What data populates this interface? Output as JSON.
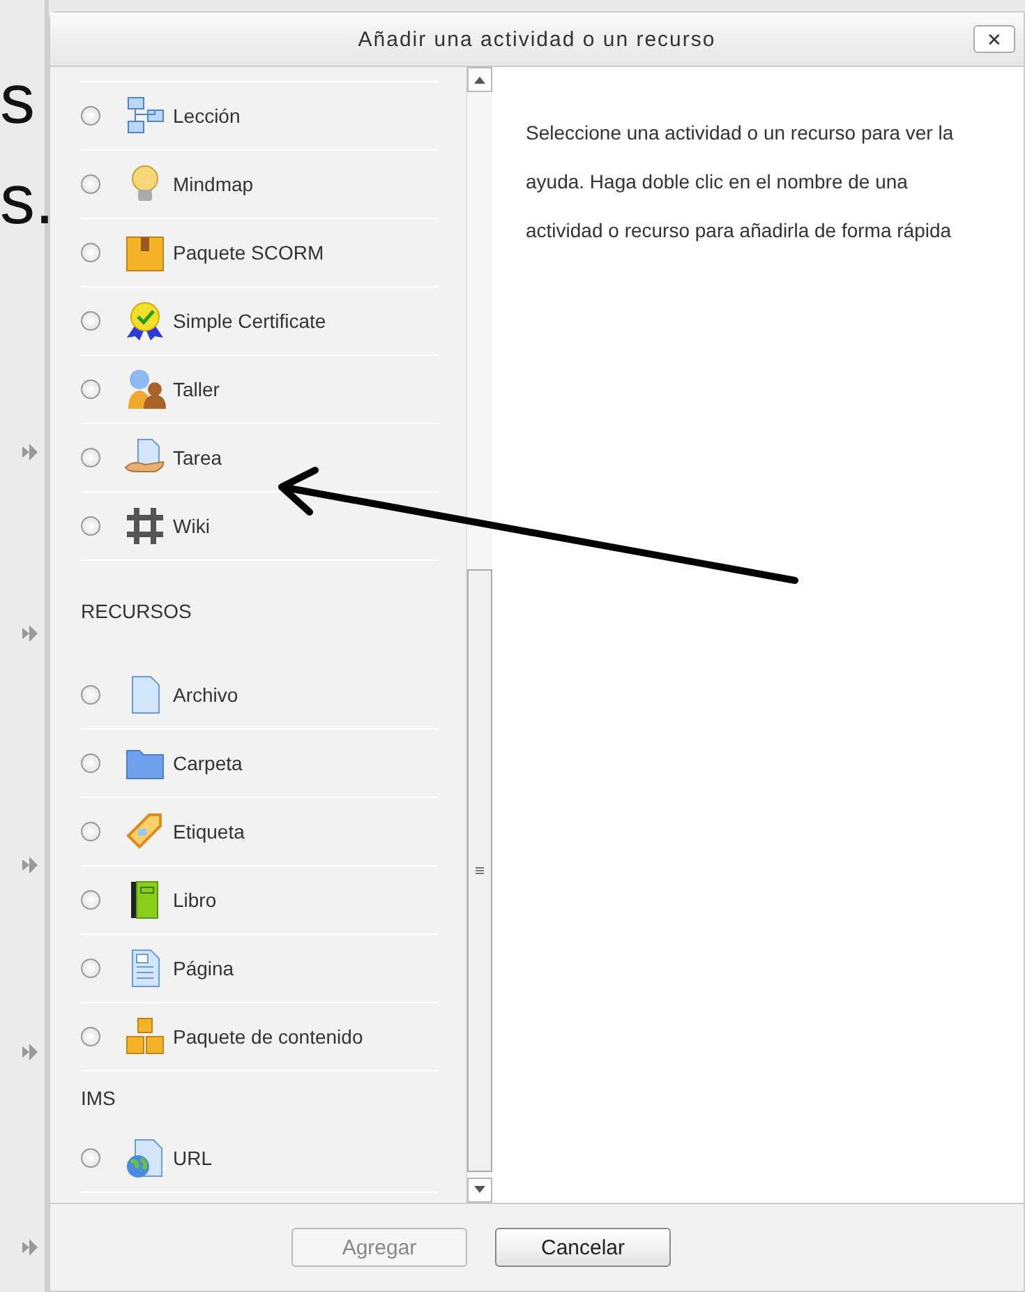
{
  "background_text": [
    "s",
    "s."
  ],
  "dialog": {
    "title": "Añadir una actividad o un recurso",
    "close": "✕",
    "entries": [
      {
        "kind": "item",
        "label": "Lección",
        "selected": false
      },
      {
        "kind": "item",
        "label": "Mindmap",
        "selected": false
      },
      {
        "kind": "item",
        "label": "Paquete SCORM",
        "selected": false
      },
      {
        "kind": "item",
        "label": "Simple Certificate",
        "selected": false
      },
      {
        "kind": "item",
        "label": "Taller",
        "selected": false
      },
      {
        "kind": "item",
        "label": "Tarea",
        "selected": false
      },
      {
        "kind": "item",
        "label": "Wiki",
        "selected": false
      },
      {
        "kind": "header",
        "label": "RECURSOS"
      },
      {
        "kind": "item",
        "label": "Archivo",
        "selected": false
      },
      {
        "kind": "item",
        "label": "Carpeta",
        "selected": false
      },
      {
        "kind": "item",
        "label": "Etiqueta",
        "selected": false
      },
      {
        "kind": "item",
        "label": "Libro",
        "selected": false
      },
      {
        "kind": "item",
        "label": "Página",
        "selected": false
      },
      {
        "kind": "item",
        "label": "Paquete de contenido",
        "selected": false
      },
      {
        "kind": "header",
        "label": "IMS"
      },
      {
        "kind": "item",
        "label": "URL",
        "selected": false
      }
    ],
    "help": "Seleccione una actividad o un recurso para ver la ayuda. Haga doble clic en el nombre de una actividad o recurso para añadirla de forma rápida",
    "buttons": [
      {
        "label": "Agregar",
        "disabled": true
      },
      {
        "label": "Cancelar",
        "disabled": false
      }
    ]
  }
}
